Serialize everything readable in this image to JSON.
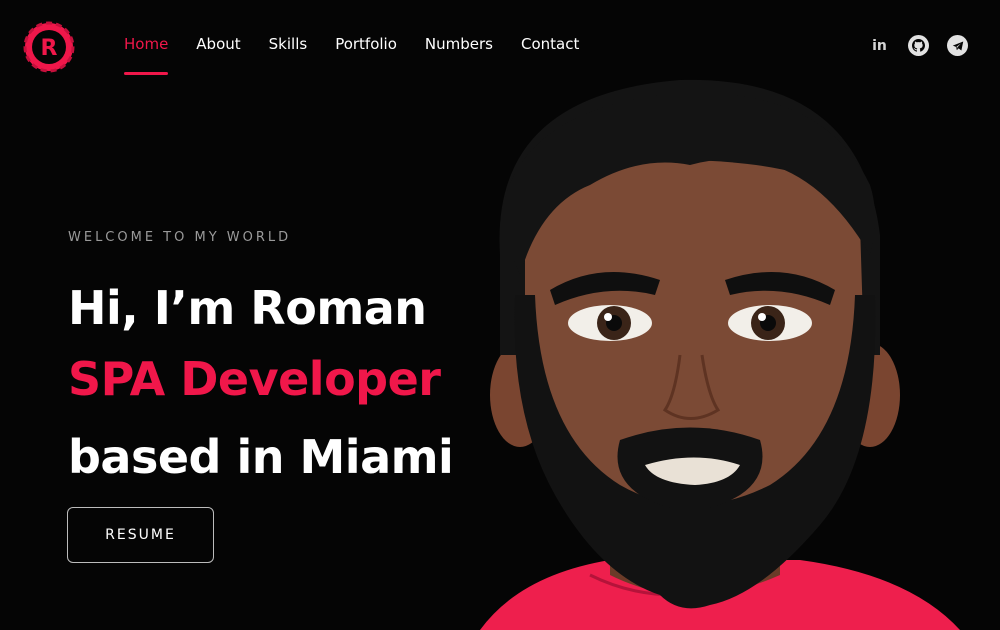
{
  "logo": {
    "icon": "logo-r-icon",
    "letter": "R"
  },
  "nav": {
    "items": [
      {
        "label": "Home",
        "active": true
      },
      {
        "label": "About",
        "active": false
      },
      {
        "label": "Skills",
        "active": false
      },
      {
        "label": "Portfolio",
        "active": false
      },
      {
        "label": "Numbers",
        "active": false
      },
      {
        "label": "Contact",
        "active": false
      }
    ]
  },
  "social": {
    "linkedin_text": "in",
    "icons": [
      "linkedin-icon",
      "github-icon",
      "telegram-icon"
    ]
  },
  "hero": {
    "welcome": "WELCOME TO MY WORLD",
    "line1": "Hi, I’m Roman",
    "line2": "SPA Developer",
    "line3": "based in Miami",
    "button": "RESUME"
  },
  "colors": {
    "accent": "#f0174a",
    "background": "#050505",
    "text": "#ffffff",
    "muted": "#9a9a9a"
  }
}
